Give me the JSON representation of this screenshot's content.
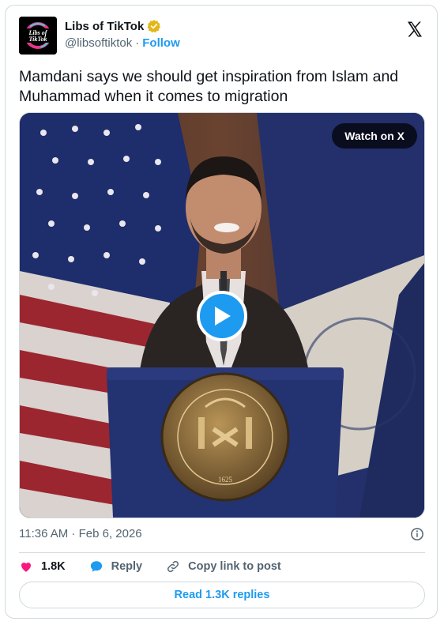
{
  "author": {
    "display_name": "Libs of TikTok",
    "handle": "@libsoftiktok",
    "separator": "·",
    "follow_label": "Follow",
    "avatar_text": [
      "Libs of",
      "TikTok"
    ]
  },
  "tweet": {
    "text": "Mamdani says we should get inspiration from Islam and Muhammad when it comes to migration"
  },
  "media": {
    "watch_label": "Watch on X",
    "seal_text": "SIGILLUM CIVITATIS NOVI EBORACI",
    "seal_year": "1625"
  },
  "meta": {
    "timestamp": "11:36 AM · Feb 6, 2026"
  },
  "actions": {
    "likes": "1.8K",
    "reply_label": "Reply",
    "copy_label": "Copy link to post",
    "read_replies_label": "Read 1.3K replies"
  },
  "colors": {
    "accent": "#1d9bf0",
    "like": "#f91880",
    "verified": "#e2b719",
    "border": "#cfd9de",
    "muted": "#536471"
  },
  "icons": [
    "x-logo-icon",
    "verified-badge-icon",
    "play-icon",
    "info-icon",
    "heart-icon",
    "reply-bubble-icon",
    "link-icon"
  ]
}
